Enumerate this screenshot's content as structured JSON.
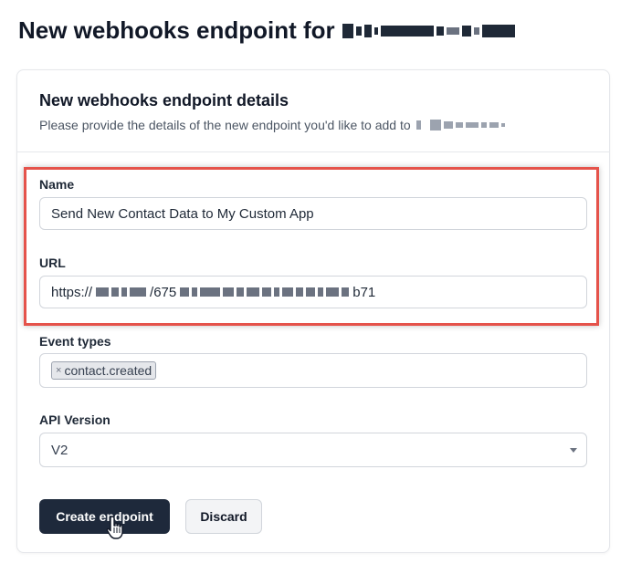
{
  "page": {
    "title": "New webhooks endpoint for"
  },
  "card": {
    "title": "New webhooks endpoint details",
    "subtitle": "Please provide the details of the new endpoint you'd like to add to"
  },
  "form": {
    "name_label": "Name",
    "name_value": "Send New Contact Data to My Custom App",
    "url_label": "URL",
    "url_prefix": "https://",
    "url_mid": "/675",
    "url_suffix": "b71",
    "event_types_label": "Event types",
    "event_types": [
      {
        "label": "contact.created",
        "remove_icon": "×"
      }
    ],
    "api_version_label": "API Version",
    "api_version_value": "V2"
  },
  "actions": {
    "create_label": "Create endpoint",
    "discard_label": "Discard"
  },
  "colors": {
    "highlight": "#e5534b",
    "primary_button": "#1e293b"
  },
  "icons": {
    "cursor": "cursor-hand-icon",
    "select": "chevron-down-icon",
    "tag_remove": "close-icon"
  }
}
